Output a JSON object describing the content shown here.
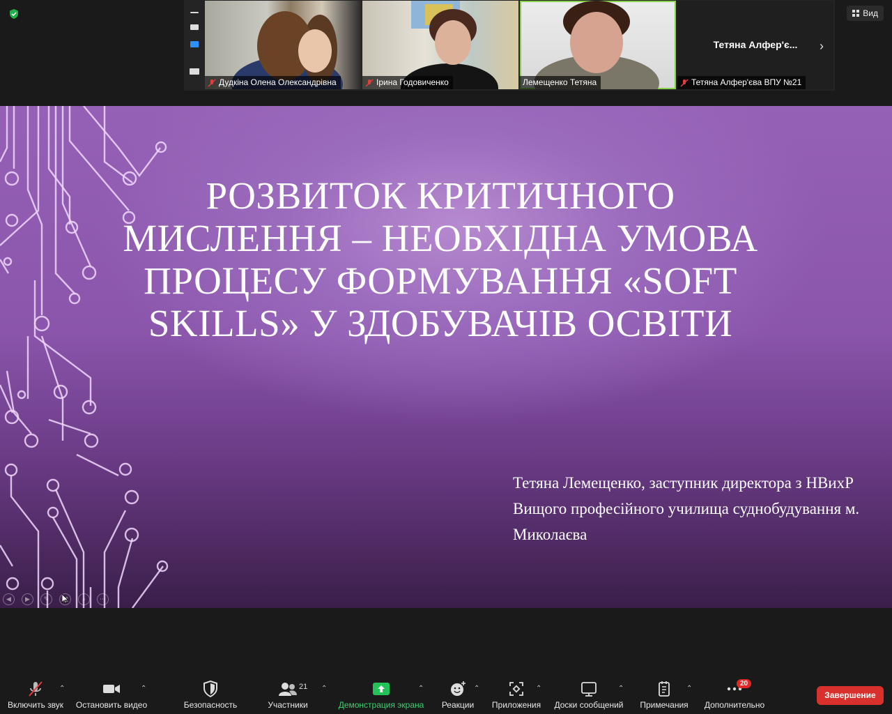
{
  "window": {
    "view_label": "Вид"
  },
  "participants_strip": {
    "tiles": [
      {
        "name": "Дудкіна Олена Олександрівна",
        "muted": true
      },
      {
        "name": "Ірина Годовиченко",
        "muted": true
      },
      {
        "name": "Лемещенко Тетяна",
        "muted": false,
        "active_speaker": true
      },
      {
        "name": "Тетяна Алфер'єва ВПУ №21",
        "display_name": "Тетяна  Алфер'є...",
        "muted": true,
        "video_off": true
      }
    ]
  },
  "slide": {
    "title": "Розвиток критичного мислення – необхідна умова процесу формування «soft skills» у здобувачів освіти",
    "subtitle": "Тетяна Лемещенко, заступник директора з НВихР Вищого професійного училища суднобудування м. Миколаєва"
  },
  "toolbar": {
    "unmute_label": "Включить звук",
    "video_label": "Остановить видео",
    "security_label": "Безопасность",
    "participants_label": "Участники",
    "participants_count": "21",
    "share_label": "Демонстрация экрана",
    "reactions_label": "Реакции",
    "apps_label": "Приложения",
    "whiteboards_label": "Доски сообщений",
    "notes_label": "Примечания",
    "more_label": "Дополнительно",
    "more_badge": "20",
    "end_label": "Завершение"
  },
  "colors": {
    "share_green": "#3bd16f",
    "end_red": "#d8312d",
    "active_speaker": "#8ad14a"
  },
  "icons": [
    "shield-check-icon",
    "grid-icon",
    "mic-muted-icon",
    "camera-icon",
    "shield-icon",
    "people-icon",
    "share-screen-icon",
    "reaction-icon",
    "apps-icon",
    "whiteboard-icon",
    "notes-icon",
    "more-icon"
  ]
}
